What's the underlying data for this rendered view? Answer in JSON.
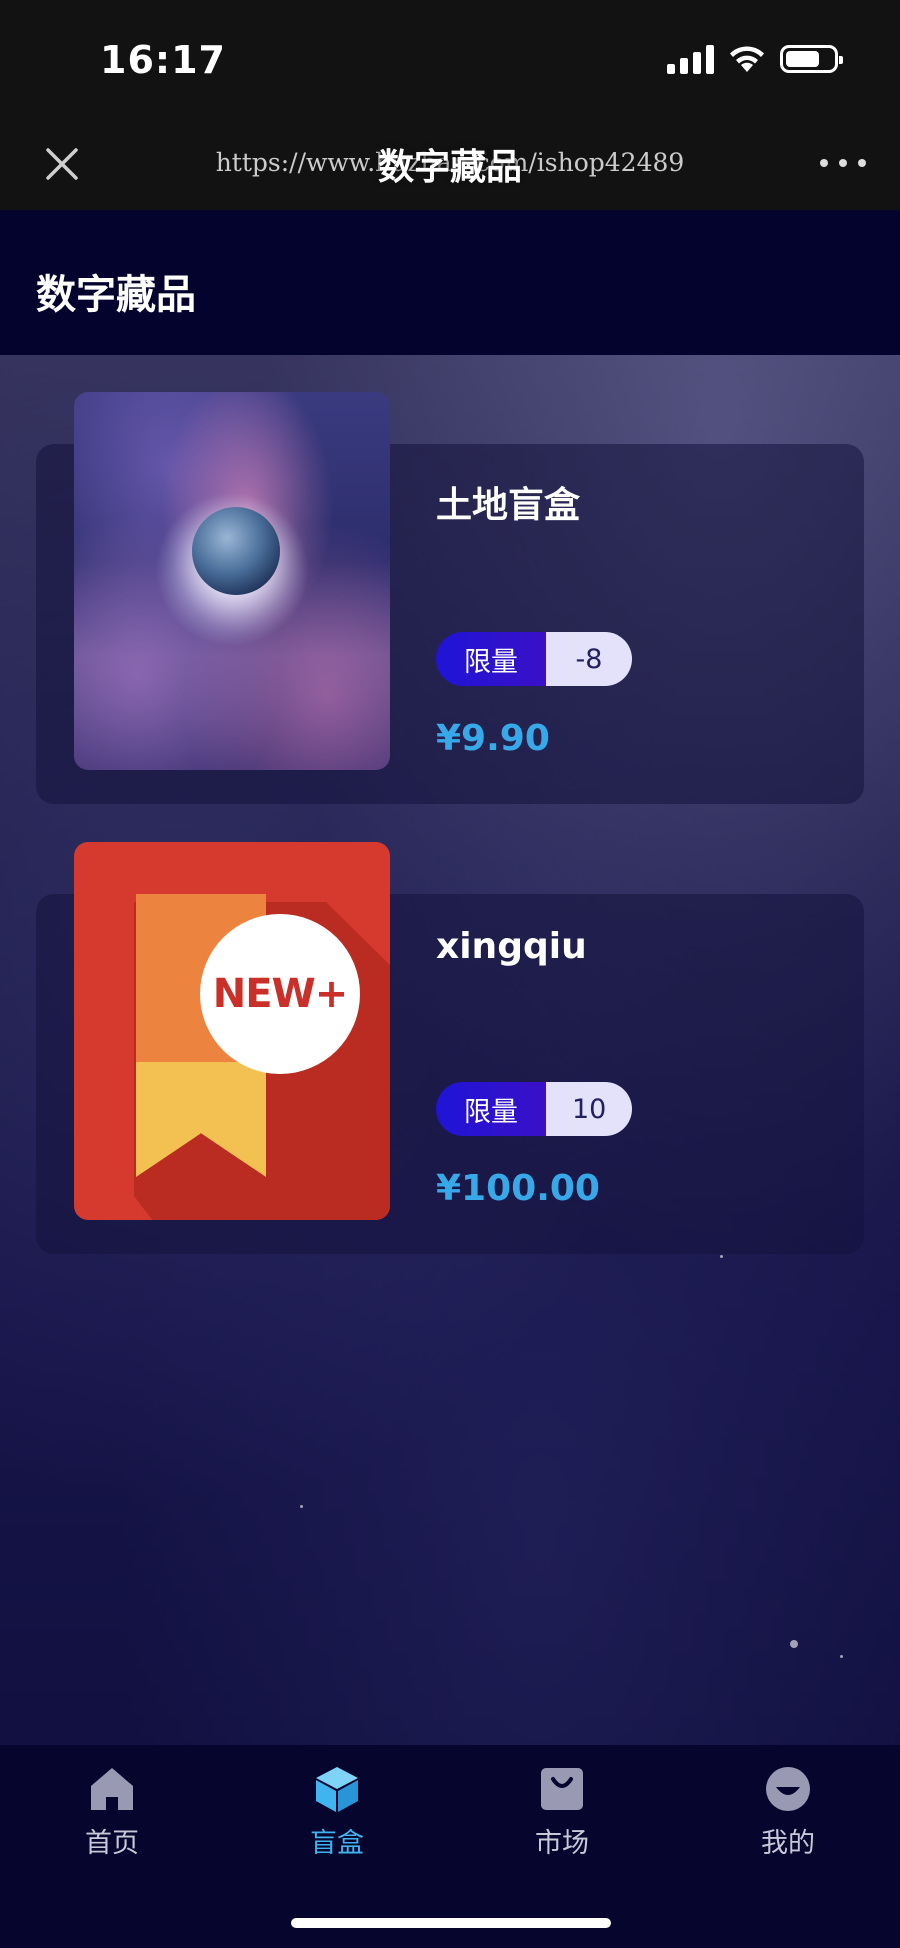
{
  "status_bar": {
    "time": "16:17"
  },
  "nav_bar": {
    "title": "数字藏品",
    "url": "https://www.huzhan.com/ishop42489"
  },
  "page": {
    "title": "数字藏品"
  },
  "products": [
    {
      "name": "土地盲盒",
      "badge_label": "限量",
      "badge_value": "-8",
      "price": "¥9.90"
    },
    {
      "name": "xingqiu",
      "badge_label": "限量",
      "badge_value": "10",
      "price": "¥100.00",
      "image_text": "NEW+"
    }
  ],
  "tabs": [
    {
      "label": "首页",
      "icon": "home-icon"
    },
    {
      "label": "盲盒",
      "icon": "box-icon",
      "active": true
    },
    {
      "label": "市场",
      "icon": "shopping-bag-icon"
    },
    {
      "label": "我的",
      "icon": "profile-icon"
    }
  ],
  "colors": {
    "accent": "#3fb4ef",
    "price": "#38a9e8",
    "badge_label_bg": "#1f14d6",
    "badge_value_bg": "#e4e2fa",
    "header_bg": "#04032e"
  }
}
